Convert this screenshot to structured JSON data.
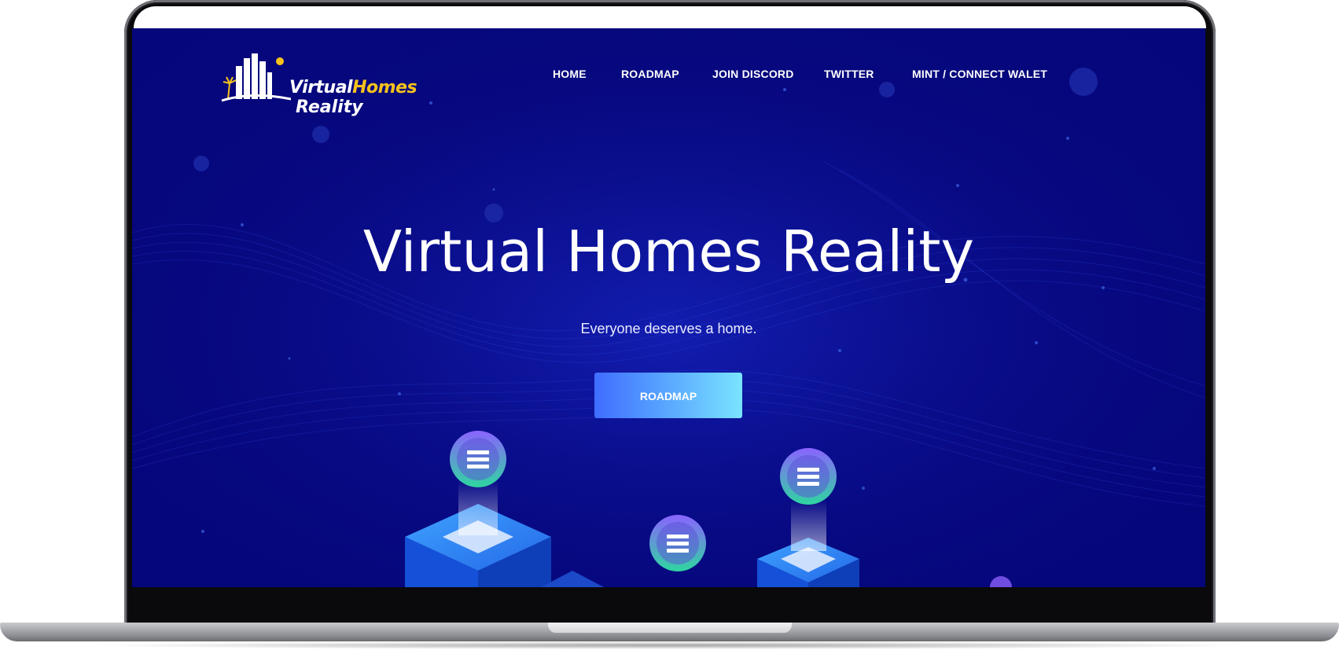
{
  "brand": {
    "logo_line1_a": "Virtual",
    "logo_line1_b": "Homes",
    "logo_line2": "Reality",
    "logo_highlight_color": "#f7c21b"
  },
  "nav": {
    "items": [
      {
        "label": "HOME"
      },
      {
        "label": "ROADMAP"
      },
      {
        "label": "JOIN DISCORD"
      },
      {
        "label": "TWITTER"
      },
      {
        "label": "MINT / CONNECT WALET"
      }
    ]
  },
  "hero": {
    "title": "Virtual Homes Reality",
    "subtitle": "Everyone deserves a home.",
    "cta_label": "ROADMAP"
  },
  "colors": {
    "background": "#07087e",
    "cta_gradient_start": "#3f6dff",
    "cta_gradient_end": "#7ae4ff",
    "coin_purple": "#7a5cff",
    "coin_green": "#2fd6a0"
  },
  "icons": [
    "solana-coin-icon",
    "building-logo-icon",
    "sun-icon",
    "palm-tree-icon"
  ]
}
